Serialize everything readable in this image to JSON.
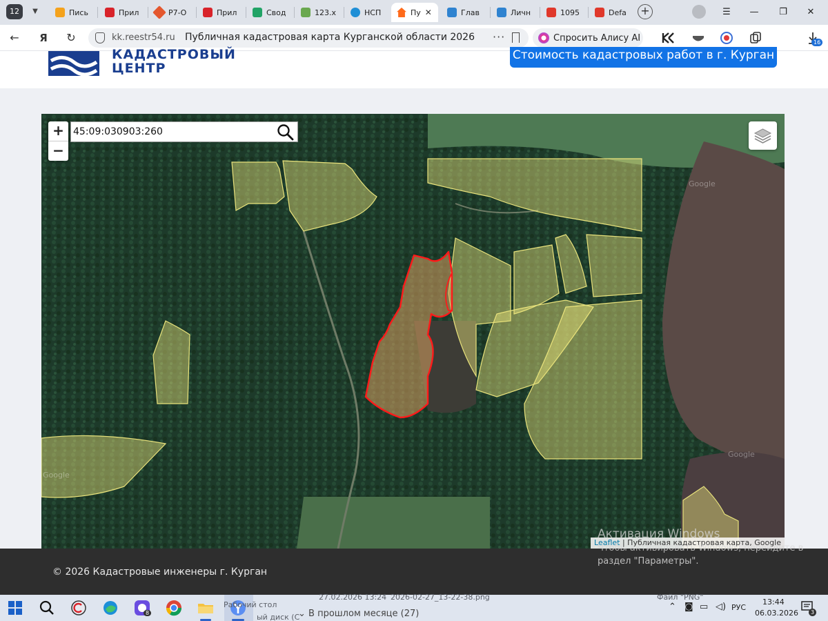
{
  "browser": {
    "tab_count": "12",
    "tabs": [
      {
        "label": "Пись",
        "color": "#f4a21c"
      },
      {
        "label": "Прил",
        "color": "#d8232a"
      },
      {
        "label": "Р7-О",
        "color": "#e4572e"
      },
      {
        "label": "Прил",
        "color": "#d8232a"
      },
      {
        "label": "Свод",
        "color": "#21a366"
      },
      {
        "label": "123.х",
        "color": "#6aa84f"
      },
      {
        "label": "НСП",
        "color": "#1f8fd6"
      },
      {
        "label": "Пу",
        "color": "#ff6a1a"
      },
      {
        "label": "Глав",
        "color": "#2f83d0"
      },
      {
        "label": "Личн",
        "color": "#2f83d0"
      },
      {
        "label": "1095",
        "color": "#e0382b"
      },
      {
        "label": "Defa",
        "color": "#e0382b"
      }
    ],
    "active_tab_index": 7,
    "close_glyph": "✕",
    "new_tab_glyph": "+",
    "address": {
      "domain": "kk.reestr54.ru",
      "page_title": "Публичная кадастровая карта Курганской области 2026",
      "more_glyph": "···"
    },
    "alice_label": "Спросить Алису AI",
    "downloads_badge": "16"
  },
  "site": {
    "logo_line1": "КАДАСТРОВЫЙ",
    "logo_line2": "ЦЕНТР",
    "cta_label": "Стоимость кадастровых работ в г. Курган",
    "footer_copy": "© 2026 Кадастровые инженеры г. Курган"
  },
  "map": {
    "zoom_in": "+",
    "zoom_out": "−",
    "search_value": "45:09:030903:260",
    "attribution_link": "Leaflet",
    "attribution_text": " | Публичная кадастровая карта, Google",
    "watermark": "Google",
    "colors": {
      "parcel_fill": "#e8e27a",
      "parcel_stroke": "#e9e37c",
      "selected_stroke": "#ff1a1a",
      "selected_fill": "#d9a060"
    }
  },
  "windows": {
    "activation_title": "Активация Windows",
    "activation_sub1": "Чтобы активировать Windows, перейдите в",
    "activation_sub2": "раздел \"Параметры\".",
    "behind_text": {
      "desktop": "Рабочий стол",
      "disk": "ый диск (С",
      "date": "27.02.2026 13:24",
      "file": "2026-02-27_13-22-38.png",
      "type": "Файл \"PNG\"",
      "last_month": "В прошлом месяце (27)"
    },
    "tray_lang": "РУС",
    "clock_time": "13:44",
    "clock_date": "06.03.2026",
    "notif_count": "3",
    "telegram_badge": "8"
  }
}
